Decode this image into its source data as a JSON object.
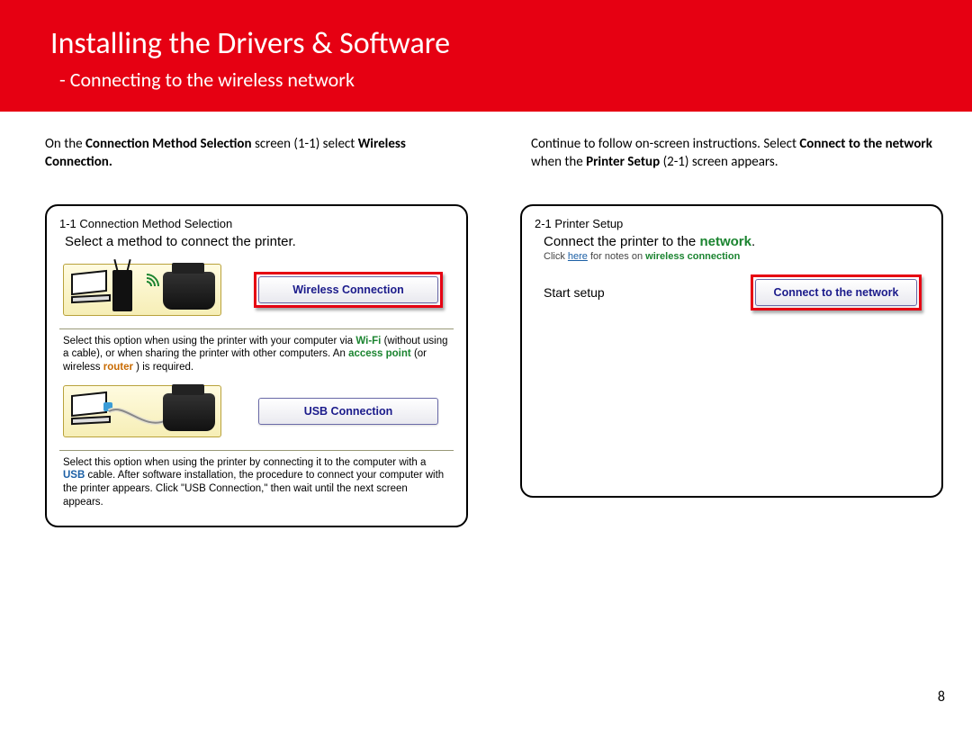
{
  "header": {
    "title": "Installing  the Drivers & Software",
    "subtitle": "- Connecting  to the wireless network"
  },
  "intro_left": {
    "pre": "On the ",
    "b1": "Connection Method Selection",
    "mid1": " screen (1-1) select ",
    "b2": "Wireless Connection."
  },
  "intro_right": {
    "pre": "Continue to follow on-screen instructions. Select ",
    "b1": "Connect to the network",
    "mid1": " when the ",
    "b2": "Printer Setup",
    "tail": " (2-1) screen appears."
  },
  "dlg1": {
    "title": "1-1 Connection Method Selection",
    "heading": "Select a method to connect the printer.",
    "wireless_btn": "Wireless Connection",
    "wireless_desc_a": "Select this option when using the printer with your computer via ",
    "wireless_desc_b": "Wi-Fi",
    "wireless_desc_c": " (without using a cable), or when sharing the printer with other computers. An ",
    "wireless_desc_d": "access point",
    "wireless_desc_e": " (or wireless ",
    "wireless_desc_f": "router",
    "wireless_desc_g": ") is required.",
    "usb_btn": "USB Connection",
    "usb_desc_a": "Select this option when using the printer by connecting it to the computer with a ",
    "usb_desc_b": "USB",
    "usb_desc_c": " cable. After software installation, the procedure to connect your computer with the printer appears. Click \"USB Connection,\" then wait until the next screen appears."
  },
  "dlg2": {
    "title": "2-1 Printer Setup",
    "line1a": "Connect the printer to the ",
    "line1b": "network",
    "tiny_a": "Click ",
    "tiny_here": "here",
    "tiny_b": " for notes on ",
    "tiny_wc": "wireless connection",
    "start": "Start setup",
    "btn": "Connect to the network"
  },
  "page_number": "8"
}
